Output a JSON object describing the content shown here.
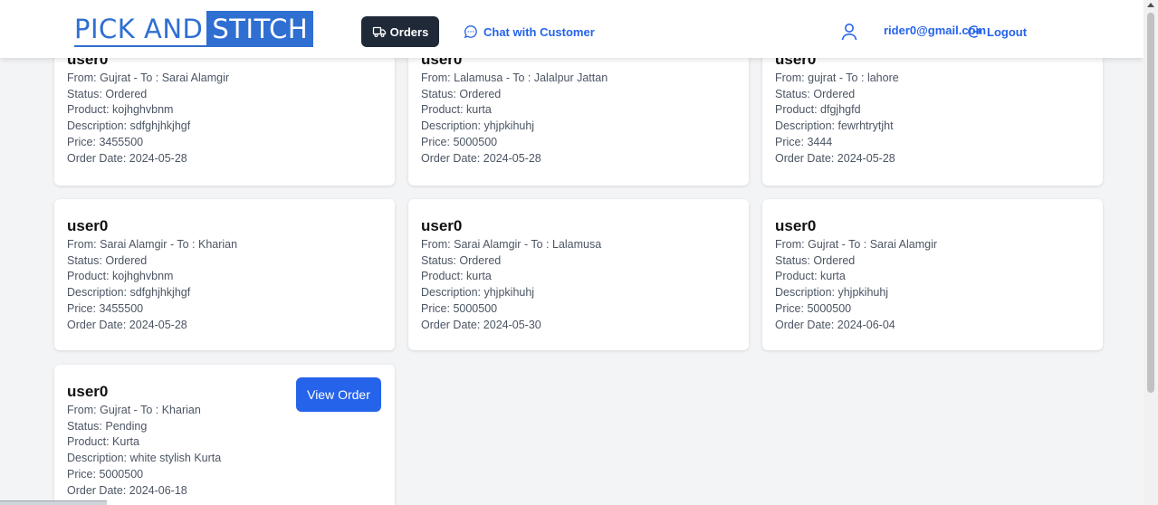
{
  "header": {
    "logo_part_a": "PICK AND",
    "logo_part_b": "STITCH",
    "orders_label": "Orders",
    "chat_label": "Chat with Customer",
    "user_email": "rider0@gmail.com",
    "logout_label": "Logout",
    "icons": [
      "truck-icon",
      "chat-bubble-icon",
      "user-icon",
      "logout-icon"
    ]
  },
  "labels": {
    "from": "From:",
    "to": "- To :",
    "status": "Status:",
    "product": "Product:",
    "description": "Description:",
    "price": "Price:",
    "order_date": "Order Date:"
  },
  "orders": [
    {
      "user": "user0",
      "from": "Gujrat",
      "to": "Sarai Alamgir",
      "status": "Ordered",
      "product": "kojhghvbnm",
      "description": "sdfghjhkjhgf",
      "price": "3455500",
      "order_date": "2024-05-28"
    },
    {
      "user": "user0",
      "from": "Lalamusa",
      "to": "Jalalpur Jattan",
      "status": "Ordered",
      "product": "kurta",
      "description": "yhjpkihuhj",
      "price": "5000500",
      "order_date": "2024-05-28"
    },
    {
      "user": "user0",
      "from": "gujrat",
      "to": "lahore",
      "status": "Ordered",
      "product": "dfgjhgfd",
      "description": "fewrhtrytjht",
      "price": "3444",
      "order_date": "2024-05-28"
    },
    {
      "user": "user0",
      "from": "Sarai Alamgir",
      "to": "Kharian",
      "status": "Ordered",
      "product": "kojhghvbnm",
      "description": "sdfghjhkjhgf",
      "price": "3455500",
      "order_date": "2024-05-28"
    },
    {
      "user": "user0",
      "from": "Sarai Alamgir",
      "to": "Lalamusa",
      "status": "Ordered",
      "product": "kurta",
      "description": "yhjpkihuhj",
      "price": "5000500",
      "order_date": "2024-05-30"
    },
    {
      "user": "user0",
      "from": "Gujrat",
      "to": "Sarai Alamgir",
      "status": "Ordered",
      "product": "kurta",
      "description": "yhjpkihuhj",
      "price": "5000500",
      "order_date": "2024-06-04"
    },
    {
      "user": "user0",
      "from": "Gujrat",
      "to": "Kharian",
      "status": "Pending",
      "product": "Kurta",
      "description": "white stylish Kurta",
      "price": "5000500",
      "order_date": "2024-06-18",
      "action_label": "View Order"
    }
  ],
  "colors": {
    "brand_blue": "#2f6fd1",
    "accent": "#2563eb",
    "orders_button": "#1f2937",
    "page_bg": "#f3f4f6"
  }
}
